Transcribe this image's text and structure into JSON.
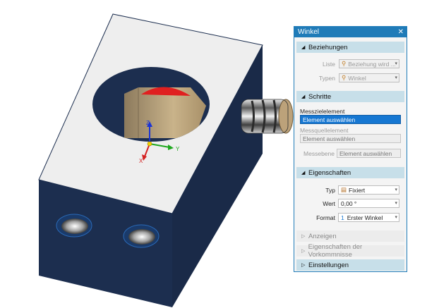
{
  "panel": {
    "title": "Winkel",
    "close_glyph": "✕",
    "sections": {
      "beziehungen": "Beziehungen",
      "schritte": "Schritte",
      "eigenschaften": "Eigenschaften",
      "anzeigen": "Anzeigen",
      "eigenschaften_vorkommnisse": "Eigenschaften der Vorkommnisse",
      "einstellungen": "Einstellungen"
    },
    "beziehungen": {
      "liste_label": "Liste",
      "liste_value": "Beziehung wird ...",
      "typen_label": "Typen",
      "typen_value": "Winkel"
    },
    "schritte": {
      "messziel_label": "Messzielelement",
      "messziel_value": "Element auswählen",
      "messquelle_label": "Messquellelement",
      "messquelle_value": "Element auswählen",
      "messebene_label": "Messebene",
      "messebene_value": "Element auswählen"
    },
    "eigenschaften": {
      "typ_label": "Typ",
      "typ_value": "Fixiert",
      "wert_label": "Wert",
      "wert_value": "0,00 °",
      "format_label": "Format",
      "format_prefix": "1",
      "format_value": "Erster Winkel"
    }
  },
  "triad": {
    "z": "Z",
    "y": "Y",
    "x": "X"
  },
  "colors": {
    "accent": "#1f7bb8",
    "block_top": "#eeeeee",
    "block_side": "#1c2e4f",
    "section_active": "#c7dfe9",
    "selection": "#1677d2"
  }
}
